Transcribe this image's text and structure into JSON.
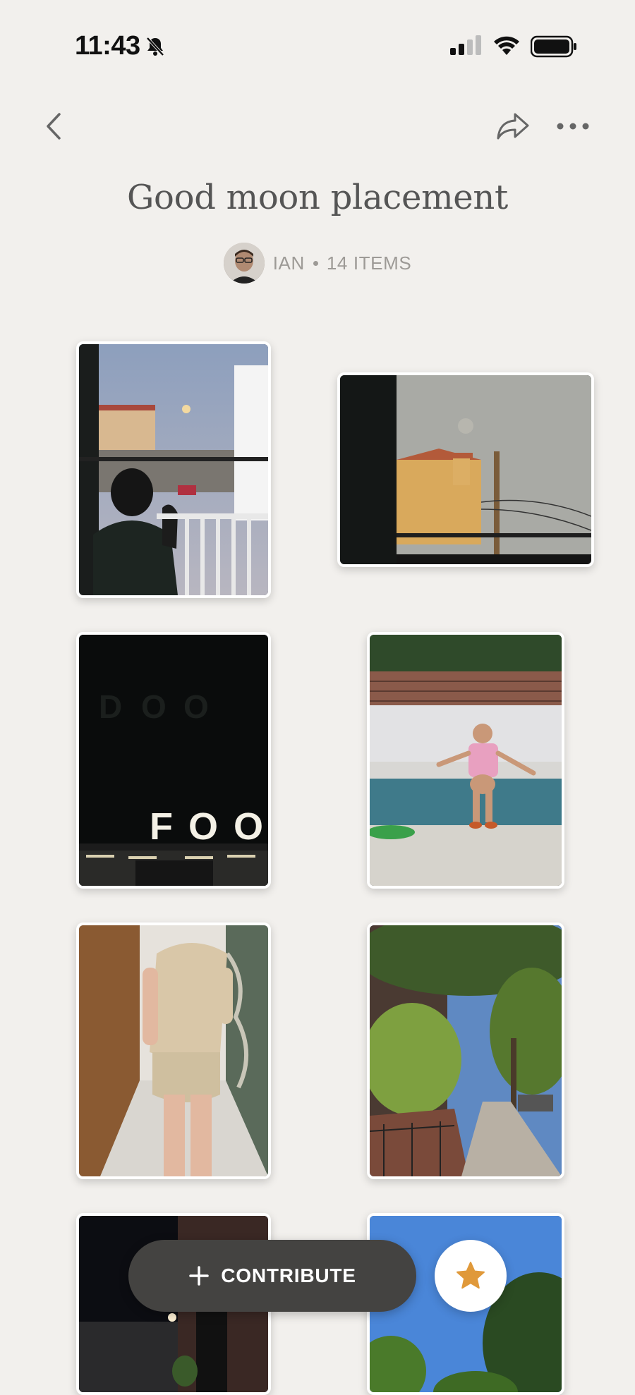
{
  "status_bar": {
    "time": "11:43"
  },
  "collection": {
    "title": "Good moon placement",
    "author": "IAN",
    "item_count": "14 ITEMS"
  },
  "icons": {
    "back": "chevron-left-icon",
    "share": "share-arrow-icon",
    "more": "ellipsis-icon",
    "contribute": "plus-icon",
    "favorite": "star-icon"
  },
  "photos": [
    {
      "subject": "child at window, full moon over houses",
      "sign_text": ""
    },
    {
      "subject": "moon over rooftops through window",
      "sign_text": ""
    },
    {
      "subject": "night building sign",
      "sign_text": "FOO"
    },
    {
      "subject": "toddler with float by pool",
      "sign_text": ""
    },
    {
      "subject": "person walking down hallway",
      "sign_text": ""
    },
    {
      "subject": "tree-lined street",
      "sign_text": ""
    },
    {
      "subject": "night street with moon",
      "sign_text": ""
    },
    {
      "subject": "trees against blue sky",
      "sign_text": ""
    }
  ],
  "actions": {
    "contribute_label": "CONTRIBUTE"
  },
  "colors": {
    "background": "#f2f0ed",
    "button_dark": "#444341",
    "star": "#e0993a"
  }
}
